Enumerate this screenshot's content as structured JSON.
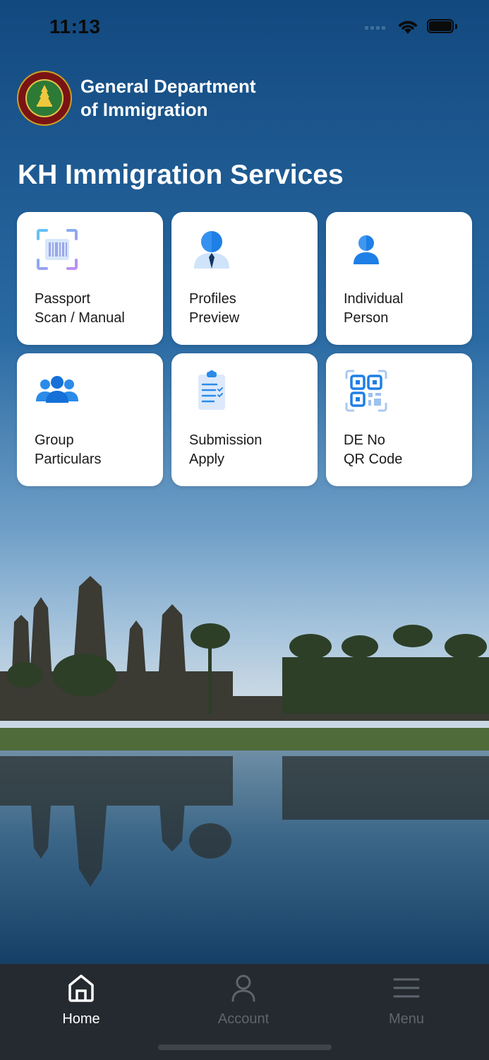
{
  "status_bar": {
    "time": "11:13"
  },
  "header": {
    "department_line1": "General Department",
    "department_line2": "of Immigration"
  },
  "page_title": "KH Immigration Services",
  "services": [
    {
      "line1": "Passport",
      "line2": "Scan / Manual",
      "icon": "barcode-scan-icon"
    },
    {
      "line1": "Profiles",
      "line2": "Preview",
      "icon": "profile-person-icon"
    },
    {
      "line1": "Individual",
      "line2": "Person",
      "icon": "single-person-icon"
    },
    {
      "line1": "Group",
      "line2": "Particulars",
      "icon": "group-people-icon"
    },
    {
      "line1": "Submission",
      "line2": "Apply",
      "icon": "clipboard-checklist-icon"
    },
    {
      "line1": "DE No",
      "line2": "QR Code",
      "icon": "qr-code-icon"
    }
  ],
  "tab_bar": {
    "home": "Home",
    "account": "Account",
    "menu": "Menu",
    "active": "home"
  },
  "colors": {
    "sky_top": "#12497f",
    "tab_bar_bg": "#252a30",
    "icon_blue": "#1e7fe6"
  }
}
